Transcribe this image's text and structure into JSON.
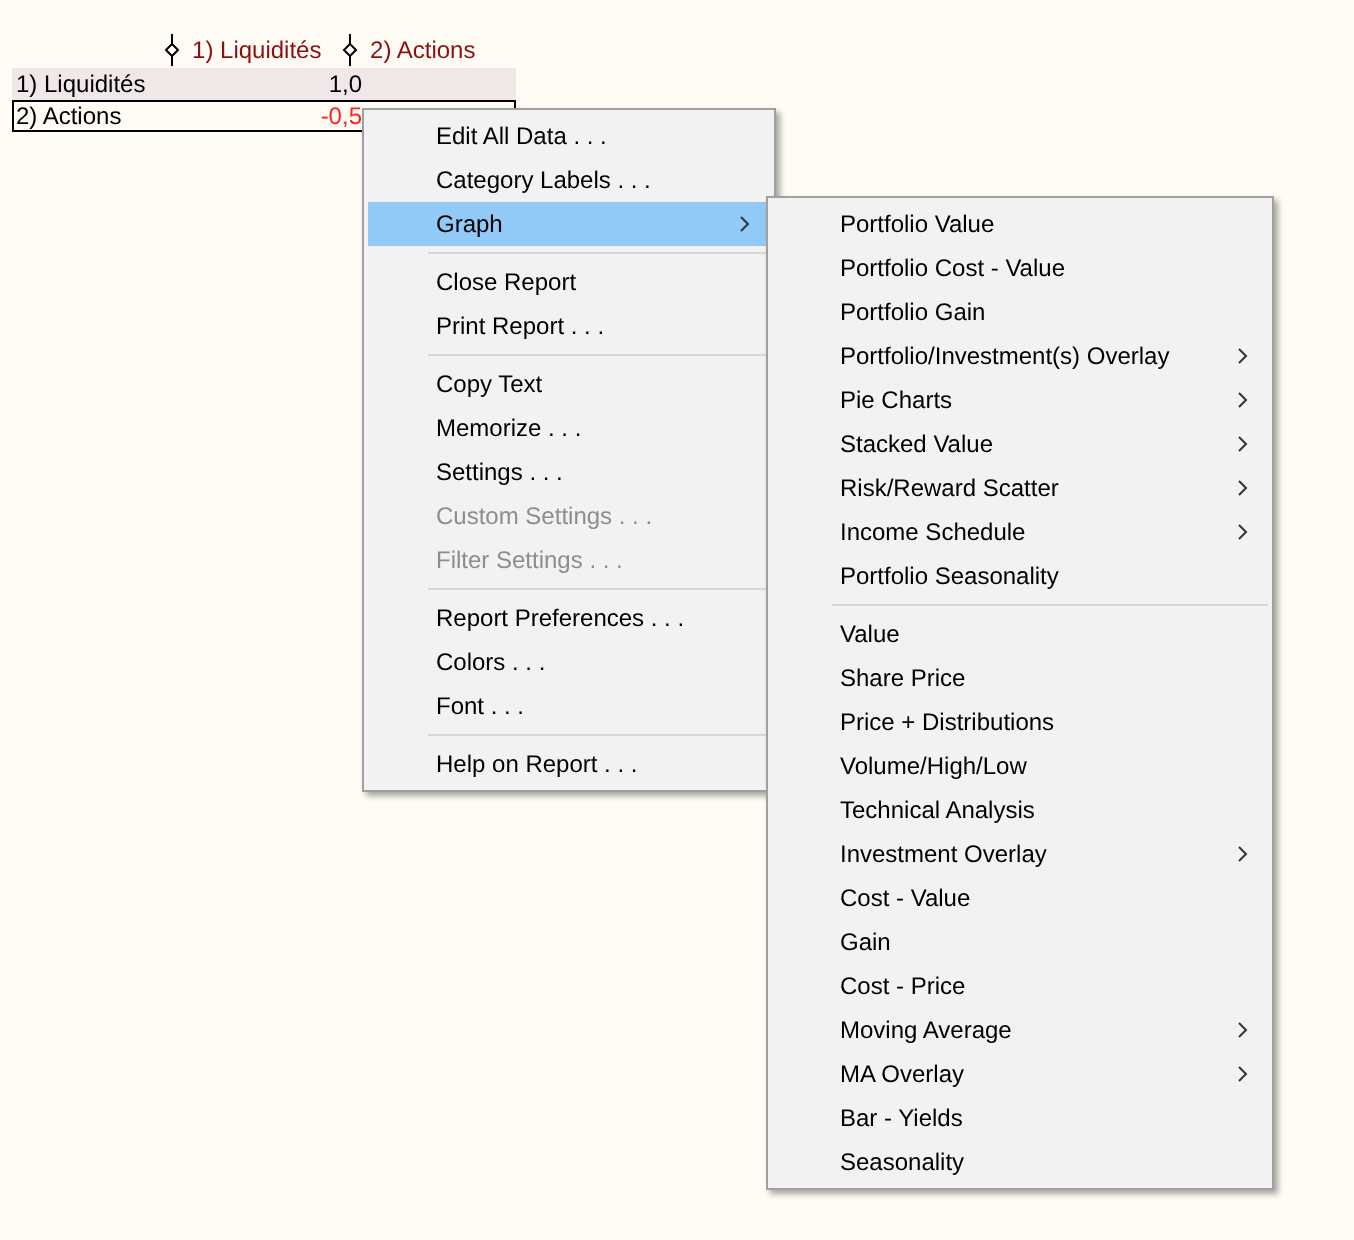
{
  "table": {
    "columns": [
      {
        "label": "1) Liquidités"
      },
      {
        "label": "2) Actions"
      }
    ],
    "rows": [
      {
        "label": "1) Liquidités",
        "cells": [
          "1,0"
        ],
        "selected": false,
        "negative": [
          false
        ]
      },
      {
        "label": "2) Actions",
        "cells": [
          "-0,5"
        ],
        "selected": true,
        "negative": [
          true
        ]
      }
    ]
  },
  "context_menu": {
    "items": [
      {
        "kind": "item",
        "label": "Edit All Data . . .",
        "disabled": false,
        "selected": false,
        "submenu": false
      },
      {
        "kind": "item",
        "label": "Category Labels . . .",
        "disabled": false,
        "selected": false,
        "submenu": false
      },
      {
        "kind": "item",
        "label": "Graph",
        "disabled": false,
        "selected": true,
        "submenu": true
      },
      {
        "kind": "separator"
      },
      {
        "kind": "item",
        "label": "Close Report",
        "disabled": false,
        "selected": false,
        "submenu": false
      },
      {
        "kind": "item",
        "label": "Print Report . . .",
        "disabled": false,
        "selected": false,
        "submenu": false
      },
      {
        "kind": "separator"
      },
      {
        "kind": "item",
        "label": "Copy Text",
        "disabled": false,
        "selected": false,
        "submenu": false
      },
      {
        "kind": "item",
        "label": "Memorize . . .",
        "disabled": false,
        "selected": false,
        "submenu": false
      },
      {
        "kind": "item",
        "label": "Settings . . .",
        "disabled": false,
        "selected": false,
        "submenu": false
      },
      {
        "kind": "item",
        "label": "Custom Settings . . .",
        "disabled": true,
        "selected": false,
        "submenu": false
      },
      {
        "kind": "item",
        "label": "Filter Settings . . .",
        "disabled": true,
        "selected": false,
        "submenu": false
      },
      {
        "kind": "separator"
      },
      {
        "kind": "item",
        "label": "Report Preferences . . .",
        "disabled": false,
        "selected": false,
        "submenu": false
      },
      {
        "kind": "item",
        "label": "Colors . . .",
        "disabled": false,
        "selected": false,
        "submenu": false
      },
      {
        "kind": "item",
        "label": "Font . . .",
        "disabled": false,
        "selected": false,
        "submenu": false
      },
      {
        "kind": "separator"
      },
      {
        "kind": "item",
        "label": "Help on Report . . .",
        "disabled": false,
        "selected": false,
        "submenu": false
      }
    ]
  },
  "graph_submenu": {
    "items": [
      {
        "kind": "item",
        "label": "Portfolio Value",
        "disabled": false,
        "selected": false,
        "submenu": false
      },
      {
        "kind": "item",
        "label": "Portfolio Cost - Value",
        "disabled": false,
        "selected": false,
        "submenu": false
      },
      {
        "kind": "item",
        "label": "Portfolio Gain",
        "disabled": false,
        "selected": false,
        "submenu": false
      },
      {
        "kind": "item",
        "label": "Portfolio/Investment(s) Overlay",
        "disabled": false,
        "selected": false,
        "submenu": true
      },
      {
        "kind": "item",
        "label": "Pie Charts",
        "disabled": false,
        "selected": false,
        "submenu": true
      },
      {
        "kind": "item",
        "label": "Stacked Value",
        "disabled": false,
        "selected": false,
        "submenu": true
      },
      {
        "kind": "item",
        "label": "Risk/Reward Scatter",
        "disabled": false,
        "selected": false,
        "submenu": true
      },
      {
        "kind": "item",
        "label": "Income Schedule",
        "disabled": false,
        "selected": false,
        "submenu": true
      },
      {
        "kind": "item",
        "label": "Portfolio Seasonality",
        "disabled": false,
        "selected": false,
        "submenu": false
      },
      {
        "kind": "separator"
      },
      {
        "kind": "item",
        "label": "Value",
        "disabled": false,
        "selected": false,
        "submenu": false
      },
      {
        "kind": "item",
        "label": "Share Price",
        "disabled": false,
        "selected": false,
        "submenu": false
      },
      {
        "kind": "item",
        "label": "Price + Distributions",
        "disabled": false,
        "selected": false,
        "submenu": false
      },
      {
        "kind": "item",
        "label": "Volume/High/Low",
        "disabled": false,
        "selected": false,
        "submenu": false
      },
      {
        "kind": "item",
        "label": "Technical Analysis",
        "disabled": false,
        "selected": false,
        "submenu": false
      },
      {
        "kind": "item",
        "label": "Investment Overlay",
        "disabled": false,
        "selected": false,
        "submenu": true
      },
      {
        "kind": "item",
        "label": "Cost - Value",
        "disabled": false,
        "selected": false,
        "submenu": false
      },
      {
        "kind": "item",
        "label": "Gain",
        "disabled": false,
        "selected": false,
        "submenu": false
      },
      {
        "kind": "item",
        "label": "Cost - Price",
        "disabled": false,
        "selected": false,
        "submenu": false
      },
      {
        "kind": "item",
        "label": "Moving Average",
        "disabled": false,
        "selected": false,
        "submenu": true
      },
      {
        "kind": "item",
        "label": "MA Overlay",
        "disabled": false,
        "selected": false,
        "submenu": true
      },
      {
        "kind": "item",
        "label": "Bar - Yields",
        "disabled": false,
        "selected": false,
        "submenu": false
      },
      {
        "kind": "item",
        "label": "Seasonality",
        "disabled": false,
        "selected": false,
        "submenu": false
      }
    ]
  }
}
